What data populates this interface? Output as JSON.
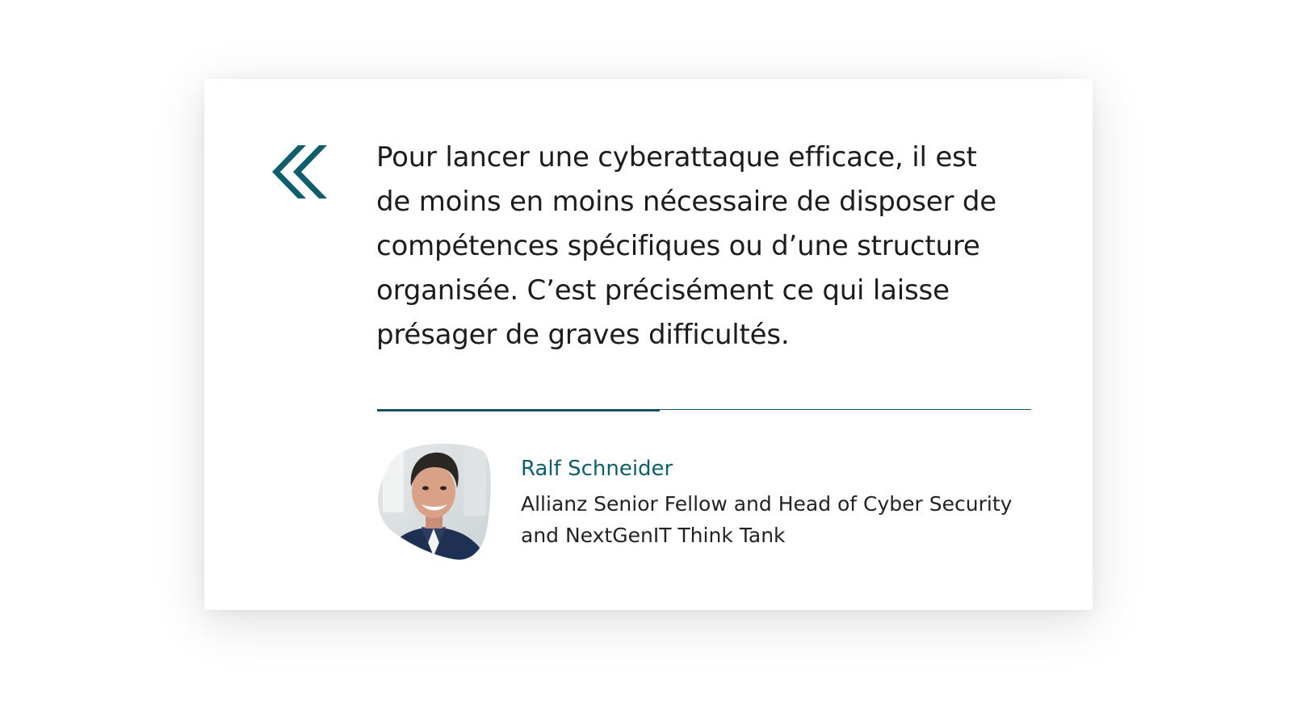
{
  "quote": {
    "lines": [
      "Pour lancer une cyberattaque efficace, il est",
      "de moins en moins nécessaire de disposer de",
      "compétences spécifiques ou d’une structure",
      "organisée. C’est précisément ce qui laisse",
      "présager de graves difficultés."
    ]
  },
  "author": {
    "name": "Ralf Schneider",
    "title_lines": [
      "Allianz Senior Fellow and Head of Cyber Security",
      "and NextGenIT Think Tank"
    ]
  },
  "colors": {
    "accent": "#0f5e6b",
    "text": "#1c1c1c",
    "background": "#ffffff"
  },
  "icons": {
    "quote_mark": "double-chevron-left-icon",
    "portrait": "avatar"
  }
}
